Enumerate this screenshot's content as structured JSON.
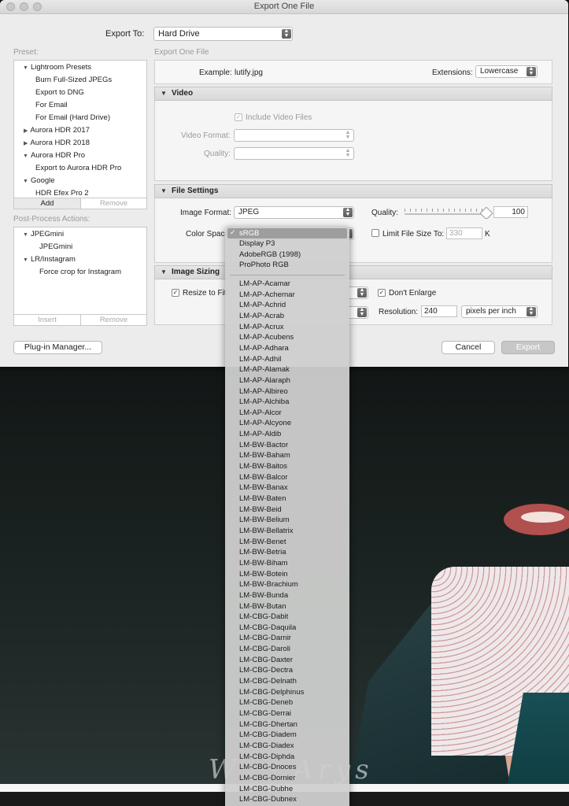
{
  "window": {
    "title": "Export One File"
  },
  "export_to": {
    "label": "Export To:",
    "value": "Hard Drive"
  },
  "preset": {
    "label": "Preset:",
    "tree": [
      {
        "label": "Lightroom Presets",
        "expanded": true,
        "level": 0
      },
      {
        "label": "Burn Full-Sized JPEGs",
        "level": 1
      },
      {
        "label": "Export to DNG",
        "level": 1
      },
      {
        "label": "For Email",
        "level": 1
      },
      {
        "label": "For Email (Hard Drive)",
        "level": 1
      },
      {
        "label": "Aurora HDR 2017",
        "expanded": false,
        "level": 0
      },
      {
        "label": "Aurora HDR 2018",
        "expanded": false,
        "level": 0
      },
      {
        "label": "Aurora HDR Pro",
        "expanded": true,
        "level": 0
      },
      {
        "label": "Export to Aurora HDR Pro",
        "level": 1
      },
      {
        "label": "Google",
        "expanded": true,
        "level": 0
      },
      {
        "label": "HDR Efex Pro 2",
        "level": 1
      }
    ],
    "add": "Add",
    "remove": "Remove"
  },
  "post_process": {
    "label": "Post-Process Actions:",
    "tree": [
      {
        "label": "JPEGmini",
        "expanded": true,
        "level": 0
      },
      {
        "label": "JPEGmini",
        "level": 1
      },
      {
        "label": "LR/Instagram",
        "expanded": true,
        "level": 0
      },
      {
        "label": "Force crop for Instagram",
        "level": 1
      }
    ],
    "insert": "Insert",
    "remove": "Remove"
  },
  "plugin_manager": "Plug-in Manager...",
  "export_heading": "Export One File",
  "example": {
    "label": "Example:",
    "value": "lutify.jpg"
  },
  "extensions": {
    "label": "Extensions:",
    "value": "Lowercase"
  },
  "video": {
    "title": "Video",
    "include_label": "Include Video Files",
    "include_checked": true,
    "format_label": "Video Format:",
    "format_value": "",
    "quality_label": "Quality:",
    "quality_value": ""
  },
  "file_settings": {
    "title": "File Settings",
    "image_format_label": "Image Format:",
    "image_format_value": "JPEG",
    "quality_label": "Quality:",
    "quality_value": "100",
    "color_space_label": "Color Space:",
    "limit_label": "Limit File Size To:",
    "limit_value": "330",
    "limit_unit": "K"
  },
  "image_sizing": {
    "title": "Image Sizing",
    "resize_label": "Resize to Fit:",
    "resize_checked": true,
    "dont_enlarge_label": "Don't Enlarge",
    "dont_enlarge_checked": true,
    "resolution_label": "Resolution:",
    "resolution_value": "240",
    "resolution_unit": "pixels per inch"
  },
  "buttons": {
    "cancel": "Cancel",
    "export": "Export"
  },
  "color_menu": {
    "selected": "sRGB",
    "standard": [
      "Display P3",
      "AdobeRGB (1998)",
      "ProPhoto RGB"
    ],
    "profiles": [
      "LM-AP-Acamar",
      "LM-AP-Achernar",
      "LM-AP-Achrid",
      "LM-AP-Acrab",
      "LM-AP-Acrux",
      "LM-AP-Acubens",
      "LM-AP-Adhara",
      "LM-AP-Adhil",
      "LM-AP-Alamak",
      "LM-AP-Alaraph",
      "LM-AP-Albireo",
      "LM-AP-Alchiba",
      "LM-AP-Alcor",
      "LM-AP-Alcyone",
      "LM-AP-Aldib",
      "LM-BW-Bactor",
      "LM-BW-Baham",
      "LM-BW-Baitos",
      "LM-BW-Balcor",
      "LM-BW-Banax",
      "LM-BW-Baten",
      "LM-BW-Beid",
      "LM-BW-Belium",
      "LM-BW-Bellatrix",
      "LM-BW-Benet",
      "LM-BW-Betria",
      "LM-BW-Biham",
      "LM-BW-Botein",
      "LM-BW-Brachium",
      "LM-BW-Bunda",
      "LM-BW-Butan",
      "LM-CBG-Dabit",
      "LM-CBG-Daquila",
      "LM-CBG-Darnir",
      "LM-CBG-Daroli",
      "LM-CBG-Daxter",
      "LM-CBG-Dectra",
      "LM-CBG-Delnath",
      "LM-CBG-Delphinus",
      "LM-CBG-Deneb",
      "LM-CBG-Derrai",
      "LM-CBG-Dhertan",
      "LM-CBG-Diadem",
      "LM-CBG-Diadex",
      "LM-CBG-Diphda",
      "LM-CBG-Dnoces",
      "LM-CBG-Dornier",
      "LM-CBG-Dubhe",
      "LM-CBG-Dubnex"
    ]
  }
}
